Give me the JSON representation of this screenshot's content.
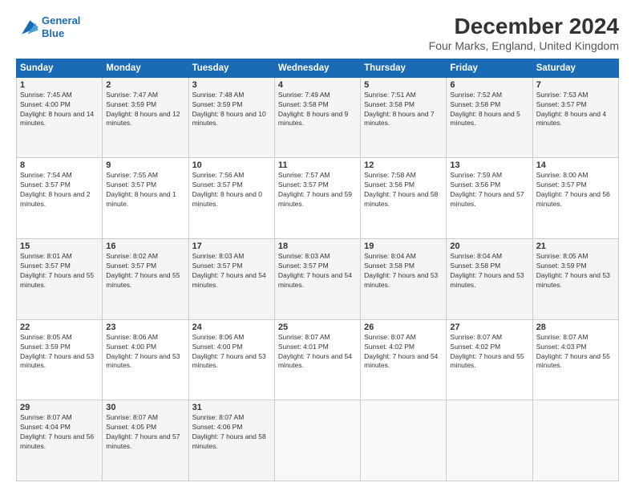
{
  "logo": {
    "line1": "General",
    "line2": "Blue"
  },
  "title": "December 2024",
  "subtitle": "Four Marks, England, United Kingdom",
  "days_of_week": [
    "Sunday",
    "Monday",
    "Tuesday",
    "Wednesday",
    "Thursday",
    "Friday",
    "Saturday"
  ],
  "weeks": [
    [
      {
        "day": 1,
        "sunrise": "7:45 AM",
        "sunset": "4:00 PM",
        "daylight": "8 hours and 14 minutes."
      },
      {
        "day": 2,
        "sunrise": "7:47 AM",
        "sunset": "3:59 PM",
        "daylight": "8 hours and 12 minutes."
      },
      {
        "day": 3,
        "sunrise": "7:48 AM",
        "sunset": "3:59 PM",
        "daylight": "8 hours and 10 minutes."
      },
      {
        "day": 4,
        "sunrise": "7:49 AM",
        "sunset": "3:58 PM",
        "daylight": "8 hours and 9 minutes."
      },
      {
        "day": 5,
        "sunrise": "7:51 AM",
        "sunset": "3:58 PM",
        "daylight": "8 hours and 7 minutes."
      },
      {
        "day": 6,
        "sunrise": "7:52 AM",
        "sunset": "3:58 PM",
        "daylight": "8 hours and 5 minutes."
      },
      {
        "day": 7,
        "sunrise": "7:53 AM",
        "sunset": "3:57 PM",
        "daylight": "8 hours and 4 minutes."
      }
    ],
    [
      {
        "day": 8,
        "sunrise": "7:54 AM",
        "sunset": "3:57 PM",
        "daylight": "8 hours and 2 minutes."
      },
      {
        "day": 9,
        "sunrise": "7:55 AM",
        "sunset": "3:57 PM",
        "daylight": "8 hours and 1 minute."
      },
      {
        "day": 10,
        "sunrise": "7:56 AM",
        "sunset": "3:57 PM",
        "daylight": "8 hours and 0 minutes."
      },
      {
        "day": 11,
        "sunrise": "7:57 AM",
        "sunset": "3:57 PM",
        "daylight": "7 hours and 59 minutes."
      },
      {
        "day": 12,
        "sunrise": "7:58 AM",
        "sunset": "3:56 PM",
        "daylight": "7 hours and 58 minutes."
      },
      {
        "day": 13,
        "sunrise": "7:59 AM",
        "sunset": "3:56 PM",
        "daylight": "7 hours and 57 minutes."
      },
      {
        "day": 14,
        "sunrise": "8:00 AM",
        "sunset": "3:57 PM",
        "daylight": "7 hours and 56 minutes."
      }
    ],
    [
      {
        "day": 15,
        "sunrise": "8:01 AM",
        "sunset": "3:57 PM",
        "daylight": "7 hours and 55 minutes."
      },
      {
        "day": 16,
        "sunrise": "8:02 AM",
        "sunset": "3:57 PM",
        "daylight": "7 hours and 55 minutes."
      },
      {
        "day": 17,
        "sunrise": "8:03 AM",
        "sunset": "3:57 PM",
        "daylight": "7 hours and 54 minutes."
      },
      {
        "day": 18,
        "sunrise": "8:03 AM",
        "sunset": "3:57 PM",
        "daylight": "7 hours and 54 minutes."
      },
      {
        "day": 19,
        "sunrise": "8:04 AM",
        "sunset": "3:58 PM",
        "daylight": "7 hours and 53 minutes."
      },
      {
        "day": 20,
        "sunrise": "8:04 AM",
        "sunset": "3:58 PM",
        "daylight": "7 hours and 53 minutes."
      },
      {
        "day": 21,
        "sunrise": "8:05 AM",
        "sunset": "3:59 PM",
        "daylight": "7 hours and 53 minutes."
      }
    ],
    [
      {
        "day": 22,
        "sunrise": "8:05 AM",
        "sunset": "3:59 PM",
        "daylight": "7 hours and 53 minutes."
      },
      {
        "day": 23,
        "sunrise": "8:06 AM",
        "sunset": "4:00 PM",
        "daylight": "7 hours and 53 minutes."
      },
      {
        "day": 24,
        "sunrise": "8:06 AM",
        "sunset": "4:00 PM",
        "daylight": "7 hours and 53 minutes."
      },
      {
        "day": 25,
        "sunrise": "8:07 AM",
        "sunset": "4:01 PM",
        "daylight": "7 hours and 54 minutes."
      },
      {
        "day": 26,
        "sunrise": "8:07 AM",
        "sunset": "4:02 PM",
        "daylight": "7 hours and 54 minutes."
      },
      {
        "day": 27,
        "sunrise": "8:07 AM",
        "sunset": "4:02 PM",
        "daylight": "7 hours and 55 minutes."
      },
      {
        "day": 28,
        "sunrise": "8:07 AM",
        "sunset": "4:03 PM",
        "daylight": "7 hours and 55 minutes."
      }
    ],
    [
      {
        "day": 29,
        "sunrise": "8:07 AM",
        "sunset": "4:04 PM",
        "daylight": "7 hours and 56 minutes."
      },
      {
        "day": 30,
        "sunrise": "8:07 AM",
        "sunset": "4:05 PM",
        "daylight": "7 hours and 57 minutes."
      },
      {
        "day": 31,
        "sunrise": "8:07 AM",
        "sunset": "4:06 PM",
        "daylight": "7 hours and 58 minutes."
      },
      null,
      null,
      null,
      null
    ]
  ]
}
